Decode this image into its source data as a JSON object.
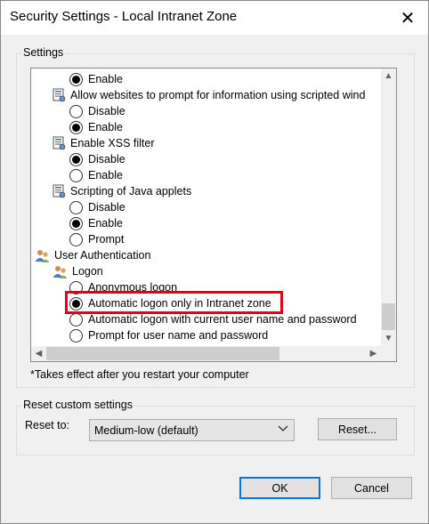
{
  "window": {
    "title": "Security Settings - Local Intranet Zone",
    "close_glyph": "✕"
  },
  "settings": {
    "group_label": "Settings",
    "tree": [
      {
        "type": "radio",
        "label": "Enable",
        "checked": true
      },
      {
        "type": "category",
        "label": "Allow websites to prompt for information using scripted wind"
      },
      {
        "type": "radio",
        "label": "Disable",
        "checked": false
      },
      {
        "type": "radio",
        "label": "Enable",
        "checked": true
      },
      {
        "type": "category",
        "label": "Enable XSS filter"
      },
      {
        "type": "radio",
        "label": "Disable",
        "checked": true
      },
      {
        "type": "radio",
        "label": "Enable",
        "checked": false
      },
      {
        "type": "category",
        "label": "Scripting of Java applets"
      },
      {
        "type": "radio",
        "label": "Disable",
        "checked": false
      },
      {
        "type": "radio",
        "label": "Enable",
        "checked": true
      },
      {
        "type": "radio",
        "label": "Prompt",
        "checked": false
      },
      {
        "type": "section",
        "label": "User Authentication"
      },
      {
        "type": "subsection",
        "label": "Logon"
      },
      {
        "type": "radio",
        "label": "Anonymous logon",
        "checked": false
      },
      {
        "type": "radio",
        "label": "Automatic logon only in Intranet zone",
        "checked": true
      },
      {
        "type": "radio",
        "label": "Automatic logon with current user name and password",
        "checked": false
      },
      {
        "type": "radio",
        "label": "Prompt for user name and password",
        "checked": false
      }
    ],
    "note": "*Takes effect after you restart your computer"
  },
  "reset": {
    "group_label": "Reset custom settings",
    "reset_to_label": "Reset to:",
    "selected_level": "Medium-low (default)",
    "reset_button": "Reset..."
  },
  "buttons": {
    "ok": "OK",
    "cancel": "Cancel"
  },
  "colors": {
    "highlight_border": "#e0001b",
    "default_button_border": "#0078d7"
  }
}
